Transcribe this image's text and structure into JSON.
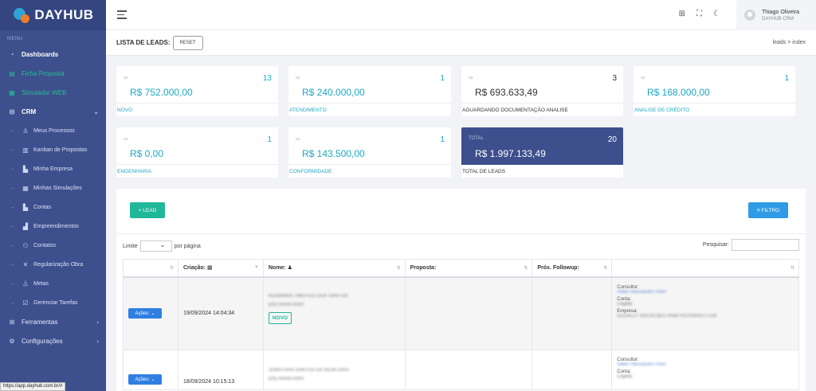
{
  "app": {
    "name": "DAYHUB"
  },
  "sidebar": {
    "menu_label": "MENU",
    "items": [
      {
        "label": "Dashboards",
        "icon": "dashboard-icon"
      },
      {
        "label": "Ficha Proposta",
        "icon": "form-icon"
      },
      {
        "label": "Simulador WEB",
        "icon": "calculator-icon"
      },
      {
        "label": "CRM",
        "icon": "grid-icon"
      }
    ],
    "crm_subitems": [
      {
        "label": "Meus Processos"
      },
      {
        "label": "Kanban de Propostas"
      },
      {
        "label": "Minha Empresa"
      },
      {
        "label": "Minhas Simulações"
      },
      {
        "label": "Contas"
      },
      {
        "label": "Empreendimentos"
      },
      {
        "label": "Contatos"
      },
      {
        "label": "Regularização Obra"
      },
      {
        "label": "Metas"
      },
      {
        "label": "Gerenciar Tarefas"
      }
    ],
    "bottom_items": [
      {
        "label": "Ferramentas"
      },
      {
        "label": "Configurações"
      }
    ]
  },
  "status_url": "https://app.dayhub.com.br/#",
  "user": {
    "name": "Thiago Oliveira",
    "company": "DAYHUB CRM"
  },
  "subheader": {
    "title": "LISTA DE LEADS:",
    "reset_label": "RESET",
    "breadcrumb": "leads  >  index"
  },
  "cards": [
    {
      "value": "R$  752.000,00",
      "count": "13",
      "label": "NOVO"
    },
    {
      "value": "R$  240.000,00",
      "count": "1",
      "label": "ATENDIMENTO"
    },
    {
      "value": "R$  693.633,49",
      "count": "3",
      "label": "AGUARDANDO DOCUMENTAÇÃO ANALISE"
    },
    {
      "value": "R$  168.000,00",
      "count": "1",
      "label": "ANALISE DE CRÉDITO"
    },
    {
      "value": "R$  0,00",
      "count": "1",
      "label": "ENGENHARIA"
    },
    {
      "value": "R$  143.500,00",
      "count": "1",
      "label": "CONFORMIDADE"
    },
    {
      "value": "R$  1.997.133,49",
      "count": "20",
      "label": "TOTAL DE LEADS",
      "mini": "TOTAL"
    }
  ],
  "panel": {
    "lead_button": "+  LEAD",
    "filter_button": "≡  FILTRO",
    "limit_label": "Limite",
    "per_page_label": "por página",
    "search_label": "Pesquisar:"
  },
  "table": {
    "headers": [
      "",
      "Criação:",
      "Nome:",
      "Proposta:",
      "Próx. Followup:",
      ""
    ],
    "rows": [
      {
        "action": "Ações:",
        "created": "19/09/2024 14:04:34",
        "name": "ROSMARA TIMOTEO DOS SANTOS",
        "phone": "(00) 00000-0000",
        "status": "NOVO",
        "consultor_label": "Consultor:",
        "consultor": "Valter Alessandro Pilori",
        "conta_label": "Conta:",
        "conta": "Legally",
        "empresa_label": "Empresa:",
        "empresa": "LEGALLY SOLUCOES HABITACIONAIS LTDA"
      },
      {
        "action": "Ações:",
        "created": "18/09/2024 10:15:13",
        "name": "JONATHAN SANTOS DA SILVA DIAS",
        "phone": "(00) 00000-0000",
        "consultor_label": "Consultor:",
        "consultor": "Valter Alessandro Pilori",
        "conta_label": "Conta:",
        "conta": "Legally"
      }
    ]
  }
}
